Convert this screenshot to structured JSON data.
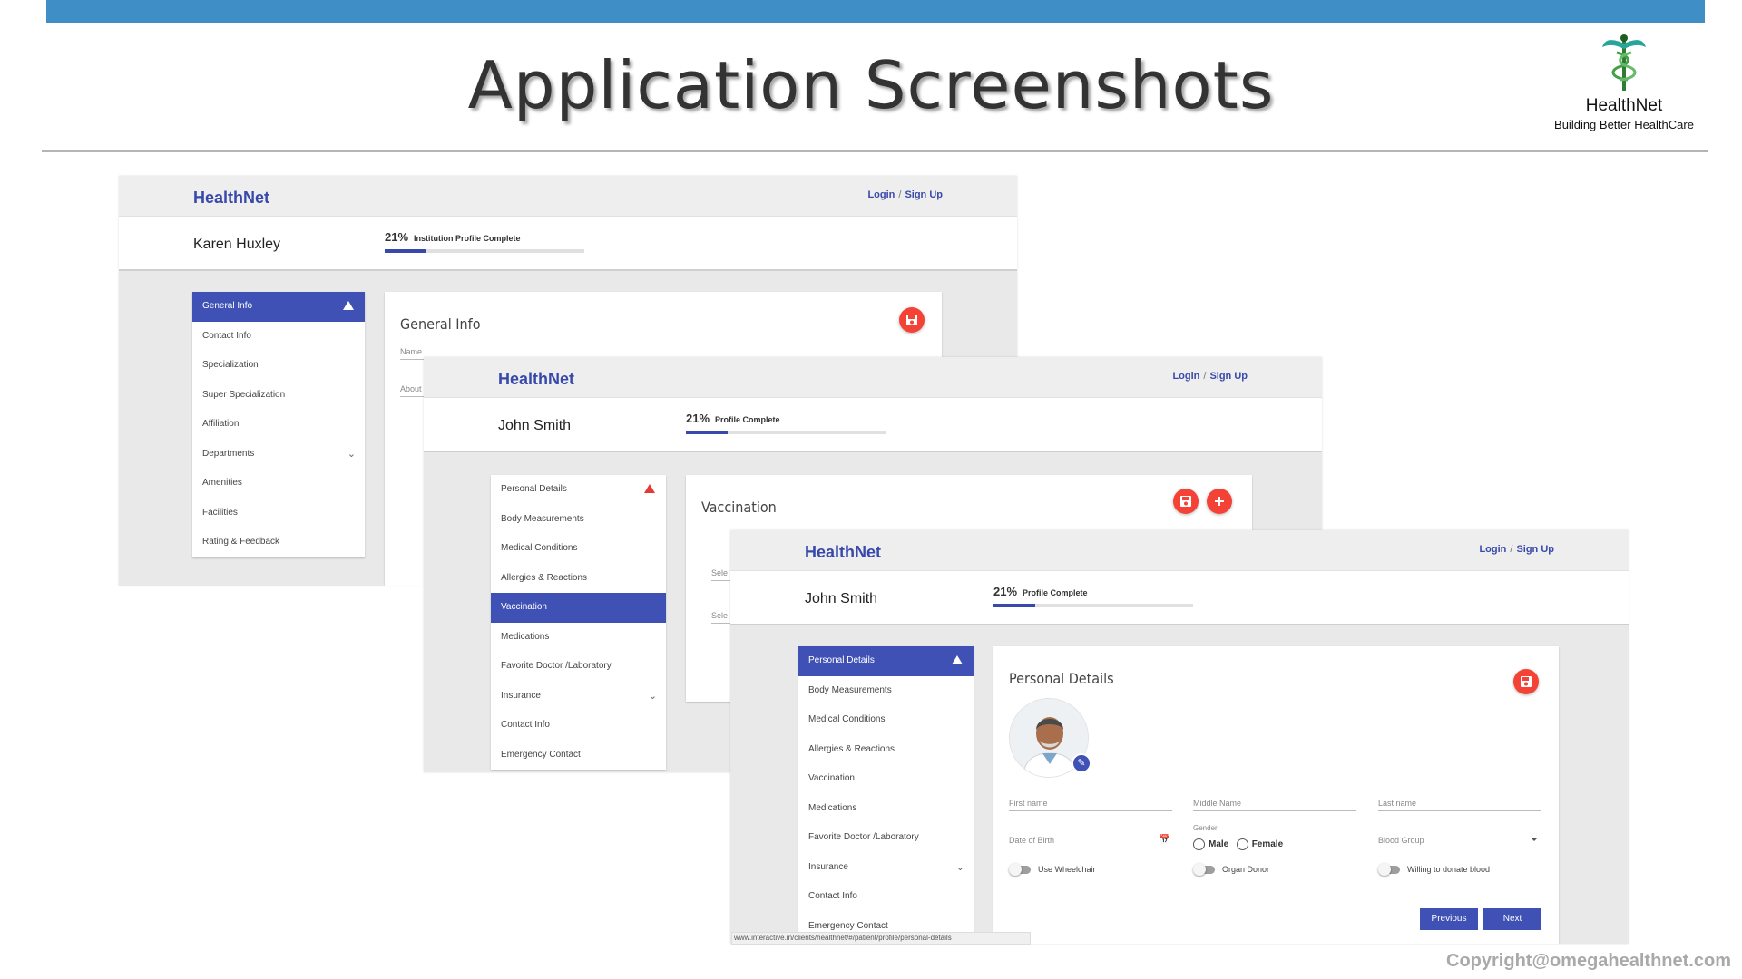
{
  "slide": {
    "title": "Application Screenshots",
    "brand_name": "HealthNet",
    "brand_tagline": "Building Better HealthCare",
    "copyright": "Copyright@omegahealthnet.com",
    "status_url": "www.interactive.in/clients/healthnet/#/patient/profile/personal-details"
  },
  "colors": {
    "topbar": "#3f8ec5",
    "primary": "#3f51b5",
    "fab": "#f44336"
  },
  "shot1": {
    "app_name": "HealthNet",
    "login": "Login",
    "sep": "/",
    "signup": "Sign Up",
    "user": "Karen Huxley",
    "progress_pct": "21%",
    "progress_value": 0.21,
    "progress_label": "Institution Profile Complete",
    "menu": [
      "General Info",
      "Contact Info",
      "Specialization",
      "Super Specialization",
      "Affiliation",
      "Departments",
      "Amenities",
      "Facilities",
      "Rating & Feedback"
    ],
    "card_title": "General Info",
    "field_name": "Name",
    "field_about": "About"
  },
  "shot2": {
    "app_name": "HealthNet",
    "login": "Login",
    "sep": "/",
    "signup": "Sign Up",
    "user": "John Smith",
    "progress_pct": "21%",
    "progress_value": 0.21,
    "progress_label": "Profile Complete",
    "menu": [
      "Personal Details",
      "Body Measurements",
      "Medical Conditions",
      "Allergies & Reactions",
      "Vaccination",
      "Medications",
      "Favorite Doctor /Laboratory",
      "Insurance",
      "Contact Info",
      "Emergency Contact"
    ],
    "card_title": "Vaccination",
    "field_select_1": "Sele",
    "field_select_2": "Sele"
  },
  "shot3": {
    "app_name": "HealthNet",
    "login": "Login",
    "sep": "/",
    "signup": "Sign Up",
    "user": "John Smith",
    "progress_pct": "21%",
    "progress_value": 0.21,
    "progress_label": "Profile Complete",
    "menu": [
      "Personal Details",
      "Body Measurements",
      "Medical Conditions",
      "Allergies & Reactions",
      "Vaccination",
      "Medications",
      "Favorite Doctor /Laboratory",
      "Insurance",
      "Contact Info",
      "Emergency Contact"
    ],
    "card_title": "Personal Details",
    "fields": {
      "first_name": "First name",
      "middle_name": "Middle Name",
      "last_name": "Last name",
      "dob": "Date of Birth",
      "gender_label": "Gender",
      "male": "Male",
      "female": "Female",
      "blood_group": "Blood Group"
    },
    "toggles": {
      "wheelchair": "Use Wheelchair",
      "organ_donor": "Organ Donor",
      "donate_blood": "Willing to donate blood"
    },
    "buttons": {
      "previous": "Previous",
      "next": "Next"
    }
  }
}
